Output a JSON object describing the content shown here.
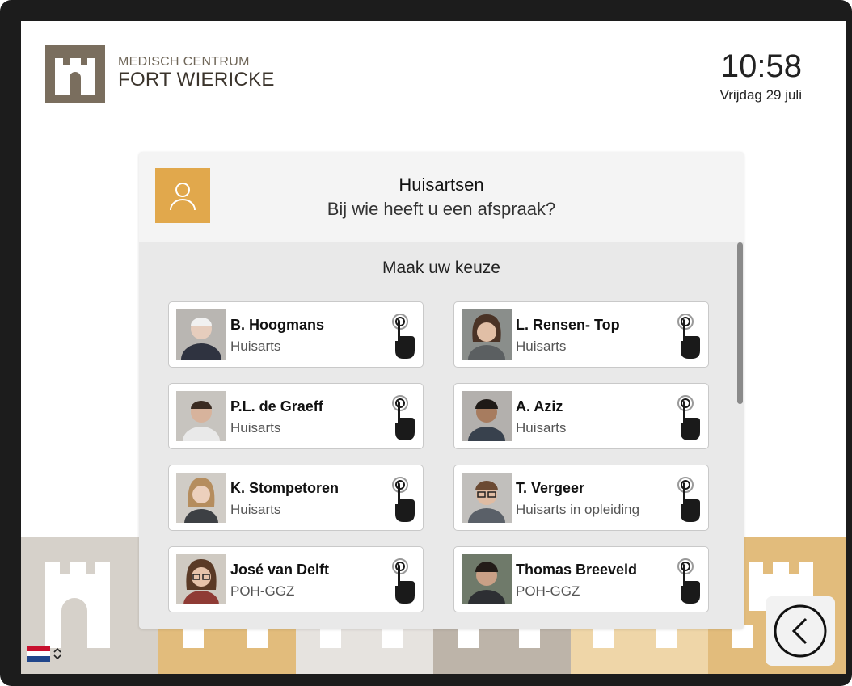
{
  "brand": {
    "line1": "MEDISCH CENTRUM",
    "line2": "FORT WIERICKE"
  },
  "clock": {
    "time": "10:58",
    "date": "Vrijdag 29 juli"
  },
  "dialog": {
    "title": "Huisartsen",
    "subtitle": "Bij wie heeft u een afspraak?",
    "icon": "person-icon",
    "prompt": "Maak uw keuze"
  },
  "doctors": [
    {
      "name": "B. Hoogmans",
      "role": "Huisarts"
    },
    {
      "name": "L. Rensen- Top",
      "role": "Huisarts"
    },
    {
      "name": "P.L. de Graeff",
      "role": "Huisarts"
    },
    {
      "name": "A. Aziz",
      "role": "Huisarts"
    },
    {
      "name": "K. Stompetoren",
      "role": "Huisarts"
    },
    {
      "name": "T. Vergeer",
      "role": "Huisarts in opleiding"
    },
    {
      "name": "José van Delft",
      "role": "POH-GGZ"
    },
    {
      "name": "Thomas Breeveld",
      "role": "POH-GGZ"
    }
  ],
  "language": {
    "icon": "dutch-flag-icon"
  },
  "colors": {
    "accent": "#e1a84c",
    "brand": "#7a6e5e",
    "castle_grey": "#d6d1ca",
    "castle_gold": "#e2bc7c"
  }
}
